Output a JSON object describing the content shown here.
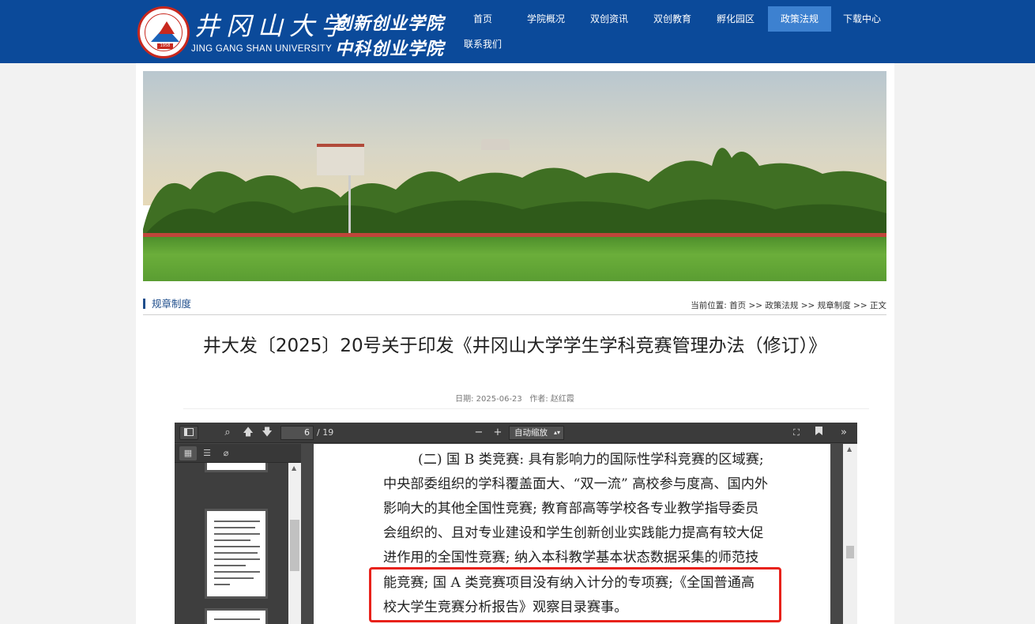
{
  "header": {
    "university_cn": "井冈山大学",
    "university_en": "JING GANG SHAN UNIVERSITY",
    "college_line1": "创新创业学院",
    "college_line2": "中科创业学院",
    "seal_year": "1958"
  },
  "nav": {
    "items": [
      "首页",
      "学院概况",
      "双创资讯",
      "双创教育",
      "孵化园区",
      "政策法规",
      "下载中心",
      "联系我们"
    ],
    "active": "政策法规"
  },
  "crumb": {
    "section": "规章制度",
    "location_label": "当前位置:",
    "path": [
      "首页",
      "政策法规",
      "规章制度",
      "正文"
    ],
    "separator": ">>"
  },
  "article": {
    "title": "井大发〔2025〕20号关于印发《井冈山大学学生学科竞赛管理办法（修订）》",
    "date_label": "日期:",
    "date": "2025-06-23",
    "author_label": "作者:",
    "author": "赵红霞"
  },
  "pdf": {
    "current_page": "6",
    "total_pages": "/ 19",
    "zoom": "自动缩放",
    "lines": [
      "(二) 国 B 类竞赛: 具有影响力的国际性学科竞赛的区域赛;",
      "中央部委组织的学科覆盖面大、“双一流” 高校参与度高、国内外",
      "影响大的其他全国性竞赛; 教育部高等学校各专业教学指导委员",
      "会组织的、且对专业建设和学生创新创业实践能力提高有较大促",
      "进作用的全国性竞赛; 纳入本科教学基本状态数据采集的师范技",
      "能竞赛; 国 A 类竞赛项目没有纳入计分的专项赛;《全国普通高",
      "校大学生竞赛分析报告》观察目录赛事。"
    ]
  },
  "colors": {
    "header_bg": "#0b4a9a",
    "nav_active": "#3d81d0",
    "highlight": "#e8221b"
  }
}
